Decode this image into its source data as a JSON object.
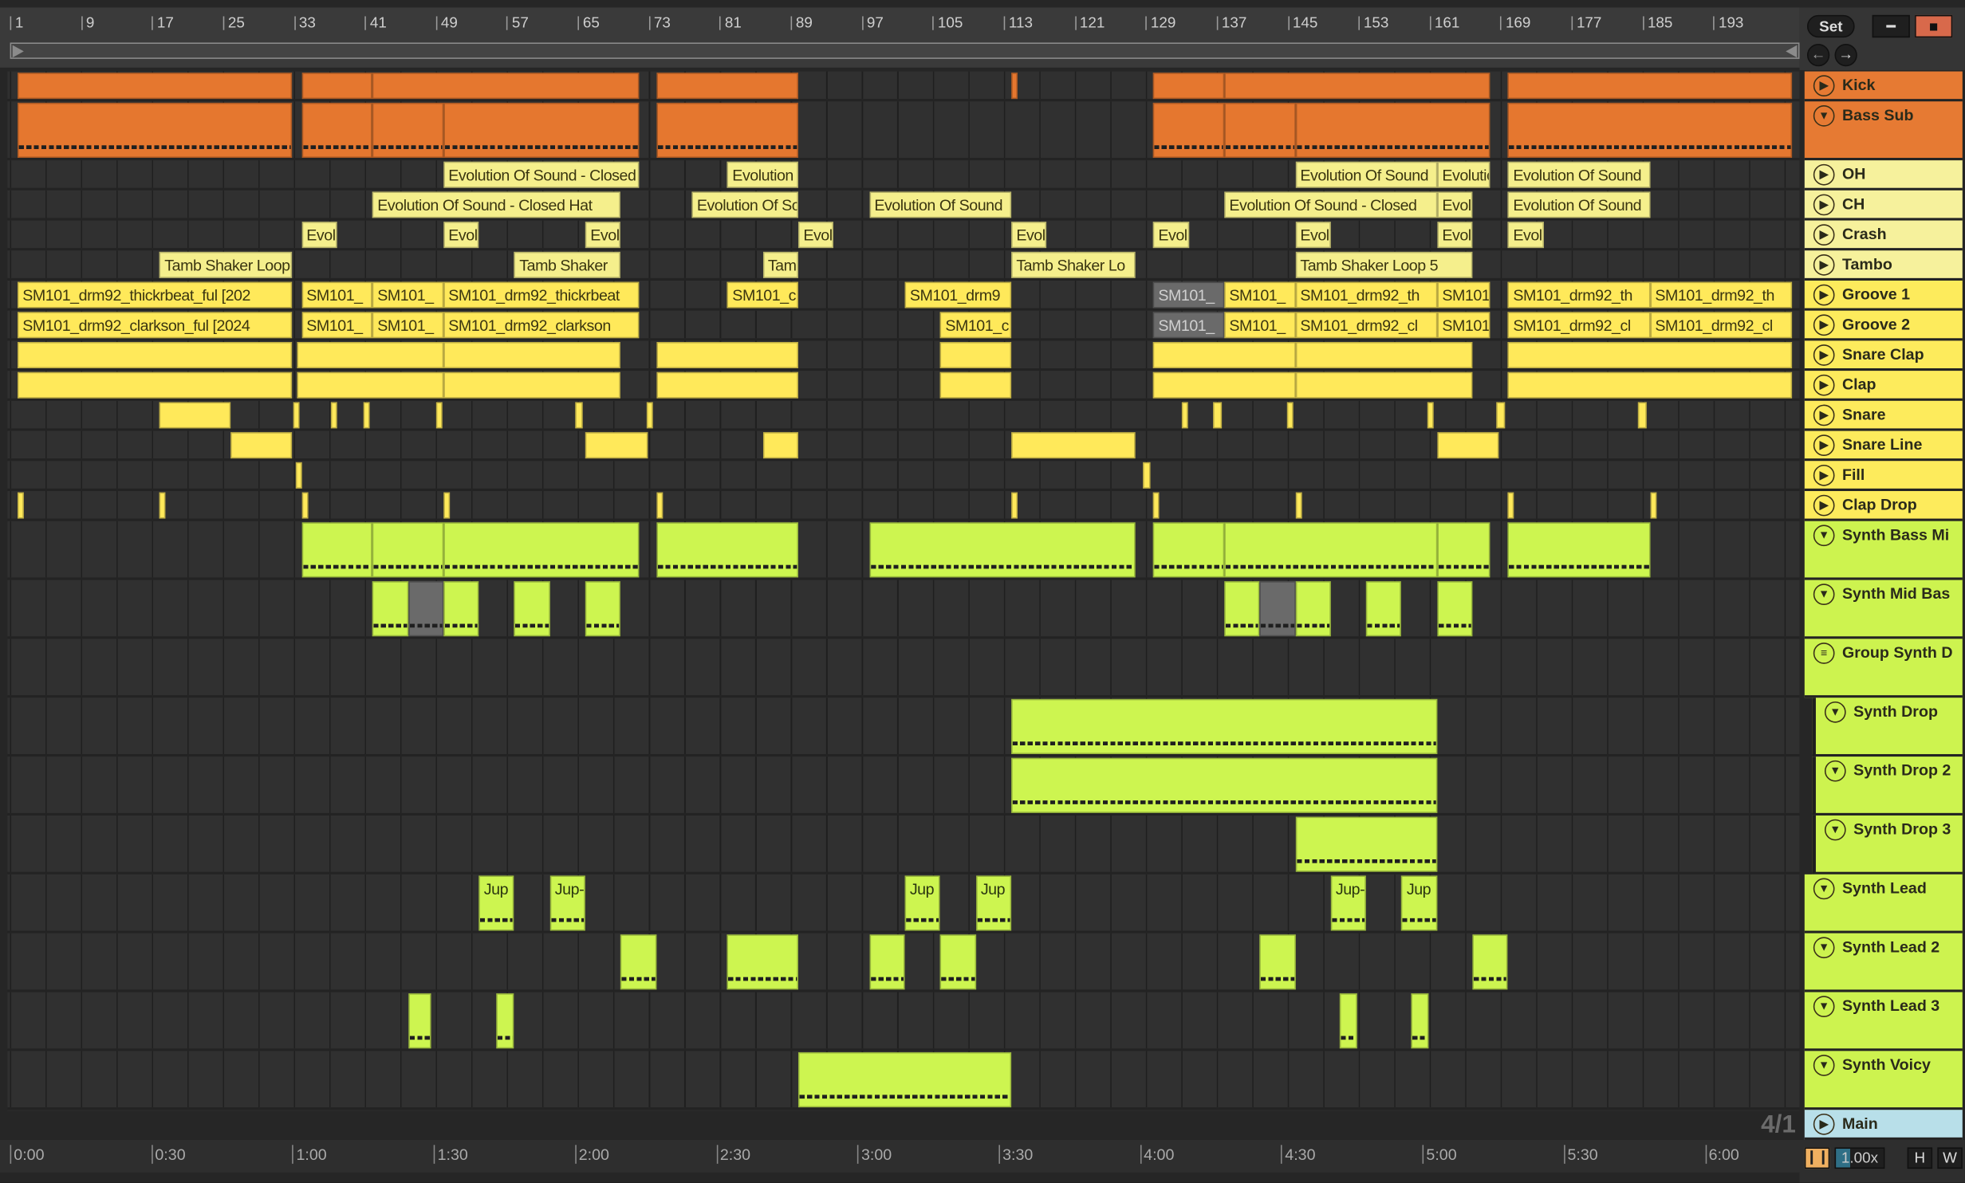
{
  "top": {
    "set_label": "Set",
    "link_icon": "draw-mode-icon",
    "lock_icon": "lock-icon",
    "back_icon": "arrow-left-icon",
    "forward_icon": "arrow-right-icon",
    "lock_color": "#d8694b"
  },
  "ruler": {
    "bars": [
      1,
      9,
      17,
      25,
      33,
      41,
      49,
      57,
      65,
      73,
      81,
      89,
      97,
      105,
      113,
      121,
      129,
      137,
      145,
      153,
      161,
      169,
      177,
      185,
      193
    ]
  },
  "time_ruler": {
    "labels": [
      [
        "0:00",
        0
      ],
      [
        "0:30",
        30
      ],
      [
        "1:00",
        60
      ],
      [
        "1:30",
        90
      ],
      [
        "2:00",
        120
      ],
      [
        "2:30",
        150
      ],
      [
        "3:00",
        180
      ],
      [
        "3:30",
        210
      ],
      [
        "4:00",
        240
      ],
      [
        "4:30",
        270
      ],
      [
        "5:00",
        300
      ],
      [
        "5:30",
        330
      ],
      [
        "6:00",
        360
      ]
    ]
  },
  "bottom": {
    "time_signature": "4/1",
    "zoom_value": "1.00x",
    "h_label": "H",
    "w_label": "W",
    "waveform_icon": "waveform-icon",
    "waveform_color": "#f0b060"
  },
  "colors": {
    "orange": "#e5772f",
    "pale": "#f5ef8c",
    "yellow": "#ffe95a",
    "lime": "#cdf550",
    "main": "#b8dfe9"
  },
  "tracks": [
    {
      "name": "Kick",
      "color": "orange",
      "icon": "play",
      "clips": [
        [
          1,
          32
        ],
        [
          33,
          41
        ],
        [
          41,
          71
        ],
        [
          73,
          89
        ],
        [
          113,
          113.2
        ],
        [
          129,
          137
        ],
        [
          137,
          167
        ],
        [
          169,
          201
        ]
      ]
    },
    {
      "name": "Bass Sub",
      "color": "orange",
      "icon": "fold",
      "expanded": true,
      "clips": [
        [
          1,
          32
        ],
        [
          33,
          41
        ],
        [
          41,
          49
        ],
        [
          49,
          71
        ],
        [
          73,
          89
        ],
        [
          129,
          137
        ],
        [
          137,
          145
        ],
        [
          145,
          167
        ],
        [
          169,
          201
        ]
      ]
    },
    {
      "name": "OH",
      "color": "pale",
      "icon": "play",
      "clips": [
        [
          49,
          71,
          "Evolution Of Sound - Closed Hat"
        ],
        [
          81,
          89,
          "Evolution Of Sound"
        ],
        [
          145,
          161,
          "Evolution Of Sound"
        ],
        [
          161,
          167,
          "Evolution Of Sound"
        ],
        [
          169,
          185,
          "Evolution Of Sound"
        ]
      ]
    },
    {
      "name": "CH",
      "color": "pale",
      "icon": "play",
      "clips": [
        [
          41,
          69,
          "Evolution Of Sound - Closed Hat"
        ],
        [
          77,
          89,
          "Evolution Of Sound"
        ],
        [
          97,
          113,
          "Evolution Of Sound"
        ],
        [
          137,
          161,
          "Evolution Of Sound - Closed"
        ],
        [
          161,
          165,
          "Evolution Of Sound"
        ],
        [
          169,
          185,
          "Evolution Of Sound"
        ]
      ]
    },
    {
      "name": "Crash",
      "color": "pale",
      "icon": "play",
      "clips": [
        [
          33,
          37,
          "Evol"
        ],
        [
          49,
          53,
          "Evol"
        ],
        [
          65,
          69,
          "Evol"
        ],
        [
          89,
          93,
          "Evol"
        ],
        [
          113,
          117,
          "Evol"
        ],
        [
          129,
          133,
          "Evol"
        ],
        [
          145,
          149,
          "Evol"
        ],
        [
          161,
          165,
          "Evol"
        ],
        [
          169,
          173,
          "Evol"
        ]
      ]
    },
    {
      "name": "Tambo",
      "color": "pale",
      "icon": "play",
      "clips": [
        [
          17,
          32,
          "Tamb Shaker Loop"
        ],
        [
          57,
          69,
          "Tamb Shaker"
        ],
        [
          85,
          89,
          "Tam"
        ],
        [
          113,
          127,
          "Tamb Shaker Lo"
        ],
        [
          145,
          165,
          "Tamb Shaker Loop 5"
        ]
      ]
    },
    {
      "name": "Groove 1",
      "color": "yellow",
      "icon": "play",
      "clips": [
        [
          1,
          32,
          "SM101_drm92_thickrbeat_ful [202"
        ],
        [
          33,
          41,
          "SM101_"
        ],
        [
          41,
          49,
          "SM101_"
        ],
        [
          49,
          71,
          "SM101_drm92_thickrbeat"
        ],
        [
          81,
          89,
          "SM101_c"
        ],
        [
          101,
          113,
          "SM101_drm9"
        ],
        [
          129,
          137,
          "SM101_",
          1
        ],
        [
          137,
          145,
          "SM101_"
        ],
        [
          145,
          161,
          "SM101_drm92_th"
        ],
        [
          161,
          167,
          "SM101"
        ],
        [
          169,
          185,
          "SM101_drm92_th"
        ],
        [
          185,
          201,
          "SM101_drm92_th"
        ]
      ]
    },
    {
      "name": "Groove 2",
      "color": "yellow",
      "icon": "play",
      "clips": [
        [
          1,
          32,
          "SM101_drm92_clarkson_ful [2024"
        ],
        [
          33,
          41,
          "SM101_"
        ],
        [
          41,
          49,
          "SM101_"
        ],
        [
          49,
          71,
          "SM101_drm92_clarkson"
        ],
        [
          105,
          113,
          "SM101_c"
        ],
        [
          129,
          137,
          "SM101_",
          1
        ],
        [
          137,
          145,
          "SM101_"
        ],
        [
          145,
          161,
          "SM101_drm92_cl"
        ],
        [
          161,
          167,
          "SM101"
        ],
        [
          169,
          185,
          "SM101_drm92_cl"
        ],
        [
          185,
          201,
          "SM101_drm92_cl"
        ]
      ]
    },
    {
      "name": "Snare Clap",
      "color": "yellow",
      "icon": "play",
      "clips": [
        [
          1,
          32
        ],
        [
          32.5,
          49
        ],
        [
          49,
          69
        ],
        [
          73,
          89
        ],
        [
          105,
          113
        ],
        [
          129,
          145
        ],
        [
          145,
          165
        ],
        [
          169,
          201
        ]
      ]
    },
    {
      "name": "Clap",
      "color": "yellow",
      "icon": "play",
      "clips": [
        [
          1,
          32
        ],
        [
          32.5,
          49
        ],
        [
          49,
          69
        ],
        [
          73,
          89
        ],
        [
          105,
          113
        ],
        [
          129,
          145
        ],
        [
          145,
          165
        ],
        [
          169,
          201
        ]
      ]
    },
    {
      "name": "Snare",
      "color": "yellow",
      "icon": "play",
      "clips": [
        [
          17,
          25
        ],
        [
          32.1,
          32.4
        ],
        [
          36.3,
          36.7
        ],
        [
          40,
          40.7
        ],
        [
          48.2,
          48.7
        ],
        [
          63.9,
          64.7
        ],
        [
          71.9,
          72.6
        ],
        [
          132.2,
          132.8
        ],
        [
          135.7,
          136.7
        ],
        [
          144.1,
          144.5
        ],
        [
          159.9,
          160.6
        ],
        [
          167.7,
          168.7
        ],
        [
          183.6,
          184.6
        ]
      ]
    },
    {
      "name": "Snare Line",
      "color": "yellow",
      "icon": "play",
      "clips": [
        [
          25,
          32
        ],
        [
          65,
          72
        ],
        [
          85,
          89
        ],
        [
          113,
          127
        ],
        [
          161,
          168
        ]
      ]
    },
    {
      "name": "Fill",
      "color": "yellow",
      "icon": "play",
      "clips": [
        [
          32.4,
          32.6
        ],
        [
          127.8,
          128.7
        ]
      ]
    },
    {
      "name": "Clap Drop",
      "color": "yellow",
      "icon": "play",
      "clips": [
        [
          1,
          1.3
        ],
        [
          17,
          17.3
        ],
        [
          33,
          33.3
        ],
        [
          49,
          49.3
        ],
        [
          73,
          73.3
        ],
        [
          113,
          113.3
        ],
        [
          129,
          129.3
        ],
        [
          145,
          145.3
        ],
        [
          169,
          169.3
        ],
        [
          185,
          185.3
        ]
      ]
    },
    {
      "name": "Synth Bass Mi",
      "color": "lime",
      "icon": "fold",
      "expanded": true,
      "clips": [
        [
          33,
          41
        ],
        [
          41,
          49
        ],
        [
          49,
          71
        ],
        [
          73,
          89
        ],
        [
          97,
          127
        ],
        [
          129,
          137
        ],
        [
          137,
          161
        ],
        [
          161,
          167
        ],
        [
          169,
          185
        ]
      ]
    },
    {
      "name": "Synth Mid Bas",
      "color": "lime",
      "icon": "fold",
      "expanded": true,
      "clips": [
        [
          41,
          45
        ],
        [
          45,
          49,
          "",
          1
        ],
        [
          49,
          53
        ],
        [
          57,
          61
        ],
        [
          65,
          69
        ],
        [
          137,
          141
        ],
        [
          141,
          145,
          "",
          1
        ],
        [
          145,
          149
        ],
        [
          153,
          157
        ],
        [
          161,
          165
        ]
      ]
    },
    {
      "name": "Group Synth D",
      "color": "lime",
      "icon": "group",
      "expanded": true,
      "clips": []
    },
    {
      "name": "Synth Drop",
      "color": "lime",
      "icon": "fold",
      "expanded": true,
      "sub": true,
      "clips": [
        [
          113,
          161
        ]
      ]
    },
    {
      "name": "Synth Drop 2",
      "color": "lime",
      "icon": "fold",
      "expanded": true,
      "sub": true,
      "clips": [
        [
          113,
          161
        ]
      ]
    },
    {
      "name": "Synth Drop 3",
      "color": "lime",
      "icon": "fold",
      "expanded": true,
      "sub": true,
      "clips": [
        [
          145,
          161
        ]
      ]
    },
    {
      "name": "Synth Lead",
      "color": "lime",
      "icon": "fold",
      "expanded": true,
      "clips": [
        [
          53,
          57,
          "Jup"
        ],
        [
          61,
          65,
          "Jup-"
        ],
        [
          101,
          105,
          "Jup"
        ],
        [
          109,
          113,
          "Jup"
        ],
        [
          149,
          153,
          "Jup-"
        ],
        [
          157,
          161,
          "Jup"
        ]
      ]
    },
    {
      "name": "Synth Lead 2",
      "color": "lime",
      "icon": "fold",
      "expanded": true,
      "clips": [
        [
          69,
          73
        ],
        [
          81,
          89
        ],
        [
          97,
          101
        ],
        [
          105,
          109
        ],
        [
          141,
          145
        ],
        [
          165,
          169
        ]
      ]
    },
    {
      "name": "Synth Lead 3",
      "color": "lime",
      "icon": "fold",
      "expanded": true,
      "clips": [
        [
          45,
          47.6
        ],
        [
          55,
          57
        ],
        [
          150,
          152
        ],
        [
          158,
          160
        ]
      ]
    },
    {
      "name": "Synth Voicy",
      "color": "lime",
      "icon": "fold",
      "expanded": true,
      "clips": [
        [
          89,
          113
        ]
      ]
    },
    {
      "name": "Main",
      "color": "main",
      "icon": "play",
      "main": true,
      "clips": []
    }
  ]
}
